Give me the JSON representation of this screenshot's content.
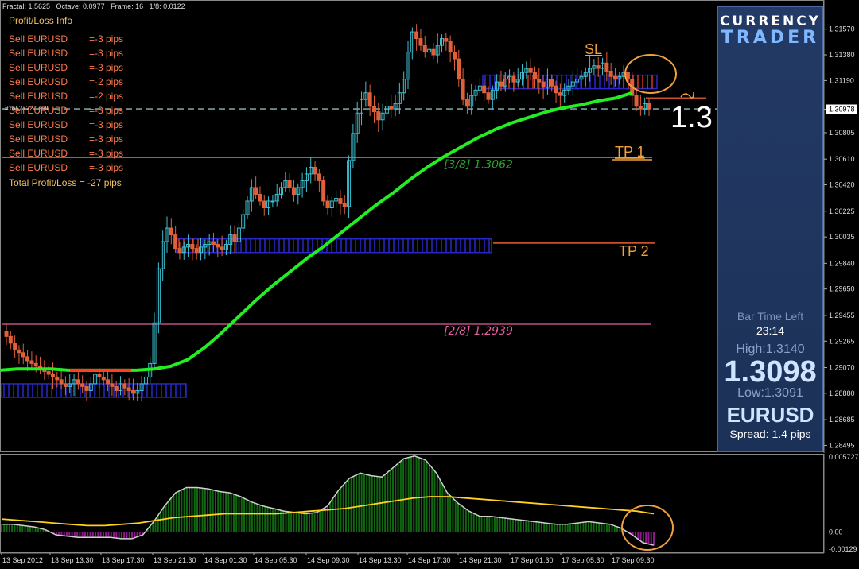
{
  "top_info": "Fractal: 1.5625   Octave: 0.0977   Frame: 16   1/8: 0.0122",
  "order_tag": "#16527227 sell",
  "profit_loss": {
    "title": "Profit/Loss Info",
    "lines": [
      {
        "label": "Sell EURUSD",
        "value": "=-3 pips"
      },
      {
        "label": "Sell EURUSD",
        "value": "=-3 pips"
      },
      {
        "label": "Sell EURUSD",
        "value": "=-3 pips"
      },
      {
        "label": "Sell EURUSD",
        "value": "=-2 pips"
      },
      {
        "label": "Sell EURUSD",
        "value": "=-2 pips"
      },
      {
        "label": "Sell EURUSD",
        "value": "=-3 pips"
      },
      {
        "label": "Sell EURUSD",
        "value": "=-3 pips"
      },
      {
        "label": "Sell EURUSD",
        "value": "=-3 pips"
      },
      {
        "label": "Sell EURUSD",
        "value": "=-3 pips"
      },
      {
        "label": "Sell EURUSD",
        "value": "=-3 pips"
      }
    ],
    "total": "Total Profit/Loss = -27 pips"
  },
  "panel": {
    "title1": "CURRENCY",
    "title2": "TRADER",
    "bar_time_left_label": "Bar Time Left",
    "bar_time_left": "23:14",
    "high": "High:1.3140",
    "price": "1.3098",
    "low": "Low:1.3091",
    "symbol": "EURUSD",
    "spread": "Spread: 1.4 pips"
  },
  "big_label": "1.3",
  "colors": {
    "up_candle": "#3fc0d0",
    "down_candle": "#e0603a",
    "ma": "#22ee22",
    "ma_red": "#ff4020",
    "zone_blue": "#2828c8",
    "zone_red": "#d03828",
    "murrey_3_8": "#2ea02e",
    "murrey_2_8": "#e060a0",
    "label_orange": "#f0a040",
    "histogram": "#116611",
    "histogram_neg": "#8a1a8a",
    "signal": "#ffd020"
  },
  "chart_data": [
    {
      "type": "candlestick",
      "symbol": "EURUSD",
      "ylim": [
        1.2848,
        1.3175
      ],
      "yticks": [
        "1.31570",
        "1.31380",
        "1.31190",
        "1.30978",
        "1.30805",
        "1.30610",
        "1.30420",
        "1.30225",
        "1.30035",
        "1.29840",
        "1.29650",
        "1.29455",
        "1.29265",
        "1.29070",
        "1.28880",
        "1.28685",
        "1.28495"
      ],
      "current_price_tag": "1.30978",
      "close": [
        1.293,
        1.2925,
        1.292,
        1.2918,
        1.2915,
        1.2912,
        1.291,
        1.2908,
        1.2906,
        1.2904,
        1.2902,
        1.29,
        1.2898,
        1.2895,
        1.2893,
        1.2895,
        1.2898,
        1.2895,
        1.2893,
        1.289,
        1.2895,
        1.2902,
        1.29,
        1.2898,
        1.2895,
        1.2893,
        1.289,
        1.2895,
        1.2892,
        1.289,
        1.2888,
        1.289,
        1.2895,
        1.29,
        1.291,
        1.294,
        1.298,
        1.3,
        1.301,
        1.3005,
        1.2995,
        1.2992,
        1.2996,
        1.2998,
        1.2995,
        1.2992,
        1.2996,
        1.2998,
        1.3,
        1.2998,
        1.2996,
        1.2994,
        1.2998,
        1.3005,
        1.3,
        1.301,
        1.302,
        1.303,
        1.304,
        1.3035,
        1.303,
        1.3025,
        1.303,
        1.303,
        1.3035,
        1.304,
        1.3045,
        1.304,
        1.3035,
        1.304,
        1.3045,
        1.305,
        1.3055,
        1.305,
        1.3045,
        1.303,
        1.3025,
        1.303,
        1.3032,
        1.3028,
        1.3026,
        1.306,
        1.308,
        1.3095,
        1.3105,
        1.311,
        1.31,
        1.3096,
        1.309,
        1.3095,
        1.31,
        1.3098,
        1.3102,
        1.311,
        1.312,
        1.314,
        1.3155,
        1.315,
        1.3145,
        1.314,
        1.3142,
        1.3138,
        1.3145,
        1.315,
        1.3148,
        1.314,
        1.3135,
        1.312,
        1.3105,
        1.31,
        1.3108,
        1.3112,
        1.3115,
        1.311,
        1.3105,
        1.3112,
        1.3118,
        1.3115,
        1.312,
        1.3122,
        1.3118,
        1.312,
        1.3125,
        1.3128,
        1.3125,
        1.312,
        1.3118,
        1.3114,
        1.312,
        1.3115,
        1.311,
        1.3108,
        1.3112,
        1.3115,
        1.3118,
        1.312,
        1.3122,
        1.3125,
        1.3128,
        1.313,
        1.3128,
        1.3132,
        1.3126,
        1.3122,
        1.312,
        1.3122,
        1.3125,
        1.312,
        1.3108,
        1.31,
        1.3098,
        1.3102,
        1.3098
      ],
      "moving_average": [
        1.2905,
        1.2906,
        1.2906,
        1.2906,
        1.2905,
        1.2905,
        1.2905,
        1.2905,
        1.2905,
        1.2906,
        1.2908,
        1.2913,
        1.2922,
        1.2933,
        1.2945,
        1.2957,
        1.2968,
        1.2978,
        1.2988,
        1.2997,
        1.3007,
        1.3017,
        1.3027,
        1.3036,
        1.3046,
        1.3055,
        1.3063,
        1.307,
        1.3077,
        1.3083,
        1.3088,
        1.3092,
        1.3096,
        1.3099,
        1.3101,
        1.3104,
        1.3106,
        1.311
      ],
      "zones": [
        {
          "name": "zone-low",
          "from": 1.2885,
          "to": 1.2895
        },
        {
          "name": "zone-mid",
          "from": 1.2992,
          "to": 1.3002
        },
        {
          "name": "zone-high",
          "from": 1.3113,
          "to": 1.3123
        }
      ],
      "levels": [
        {
          "name": "murrey-3-8",
          "value": 1.3062,
          "label": "[3/8]  1.3062"
        },
        {
          "name": "murrey-2-8",
          "value": 1.2939,
          "label": "[2/8]  1.2939"
        },
        {
          "name": "current-price",
          "value": 1.3098
        },
        {
          "name": "tp-2",
          "value": 1.2999,
          "label": "TP 2"
        },
        {
          "name": "sl-line",
          "value": 1.3106
        }
      ],
      "annotations": [
        "SL",
        "TP 1",
        "TP 2"
      ]
    },
    {
      "type": "histogram",
      "ylim": [
        -0.00129,
        0.005727
      ],
      "yticks": [
        "0.005727",
        "0.00",
        "-0.00129"
      ],
      "xticks": [
        "13 Sep 2012",
        "13 Sep 13:30",
        "13 Sep 17:30",
        "13 Sep 21:30",
        "14 Sep 01:30",
        "14 Sep 05:30",
        "14 Sep 09:30",
        "14 Sep 13:30",
        "14 Sep 17:30",
        "14 Sep 21:30",
        "17 Sep 01:30",
        "17 Sep 05:30",
        "17 Sep 09:30"
      ],
      "values": [
        0.0006,
        0.0006,
        0.0005,
        0.0004,
        0.0002,
        -0.0002,
        -0.0003,
        -0.0004,
        -0.0004,
        -0.0004,
        -0.0004,
        -0.0005,
        -0.0005,
        -0.0002,
        0.0008,
        0.002,
        0.003,
        0.0034,
        0.0034,
        0.0033,
        0.0031,
        0.003,
        0.0027,
        0.0023,
        0.002,
        0.0018,
        0.0016,
        0.0015,
        0.0014,
        0.0015,
        0.002,
        0.0032,
        0.0041,
        0.0045,
        0.0043,
        0.0042,
        0.0049,
        0.0056,
        0.0058,
        0.0055,
        0.0045,
        0.003,
        0.0022,
        0.0016,
        0.0012,
        0.0012,
        0.0011,
        0.001,
        0.0009,
        0.0008,
        0.0007,
        0.0006,
        0.0006,
        0.0007,
        0.0008,
        0.0007,
        0.0006,
        0.0003,
        -0.0002,
        -0.0008,
        -0.001
      ],
      "signal": [
        0.001,
        0.0009,
        0.0008,
        0.0007,
        0.0006,
        0.0005,
        0.0005,
        0.0006,
        0.0007,
        0.0009,
        0.0011,
        0.0012,
        0.0013,
        0.0014,
        0.0014,
        0.0014,
        0.0014,
        0.0015,
        0.0016,
        0.0017,
        0.0018,
        0.002,
        0.0022,
        0.0024,
        0.0026,
        0.0027,
        0.0027,
        0.0026,
        0.0025,
        0.0024,
        0.0023,
        0.0022,
        0.0021,
        0.002,
        0.0019,
        0.0018,
        0.0017,
        0.0016,
        0.0014
      ]
    }
  ]
}
